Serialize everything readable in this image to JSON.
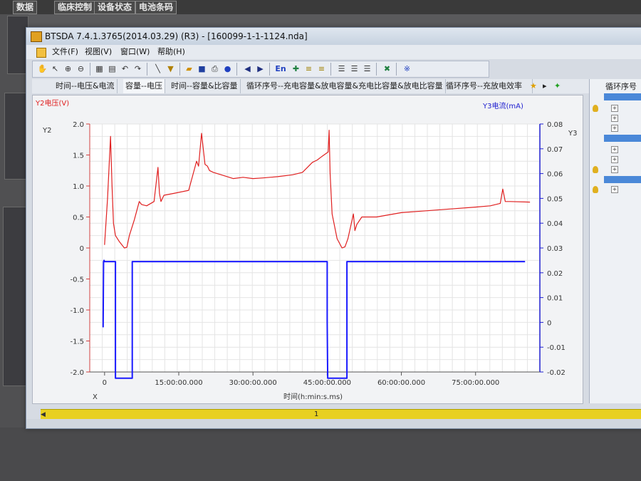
{
  "desktop_menu": [
    "数据",
    "临床控制",
    "设备状态",
    "电池条码"
  ],
  "window": {
    "title": "BTSDA 7.4.1.3765(2014.03.29) (R3) - [160099-1-1-1124.nda]"
  },
  "menubar": [
    "文件(F)",
    "视图(V)",
    "窗口(W)",
    "帮助(H)"
  ],
  "toolbar": {
    "icons": [
      "hand-icon",
      "pointer-icon",
      "zoom-in-icon",
      "zoom-out-icon",
      "table-icon",
      "grid-icon",
      "undo-icon",
      "redo-icon",
      "line-tool-icon",
      "filter-icon",
      "open-icon",
      "save-icon",
      "print-icon",
      "help-icon",
      "back-icon",
      "forward-icon",
      "lang-icon",
      "pin-icon",
      "axis-left-icon",
      "axis-right-icon",
      "layout-1-icon",
      "layout-2-icon",
      "layout-3-icon",
      "export-excel-icon",
      "settings-icon"
    ],
    "lang_label": "En"
  },
  "tabs": [
    "时间--电压&电流",
    "容量--电压",
    "时间--容量&比容量",
    "循环序号--充电容量&放电容量&充电比容量&放电比容量",
    "循环序号--充放电效率"
  ],
  "right_panel": {
    "header": "循环序号"
  },
  "scrollbar": {
    "position_label": "1"
  },
  "chart_data": {
    "type": "line",
    "xlabel": "时间(h:min:s.ms)",
    "x_axis_title": "X",
    "x_ticks": [
      "0",
      "15:00:00.000",
      "30:00:00.000",
      "45:00:00.000",
      "60:00:00.000",
      "75:00:00.000"
    ],
    "x_tick_values": [
      0,
      15,
      30,
      45,
      60,
      75
    ],
    "xlim": [
      -3,
      88
    ],
    "y2": {
      "label": "Y2电压(V)",
      "axis_title": "Y2",
      "ticks": [
        "2.0",
        "1.5",
        "1.0",
        "0.5",
        "0",
        "-0.5",
        "-1.0",
        "-1.5",
        "-2.0"
      ],
      "ylim": [
        -2.0,
        2.0
      ],
      "color": "#e02020"
    },
    "y3": {
      "label": "Y3电流(mA)",
      "axis_title": "Y3",
      "ticks": [
        "0.08",
        "0.07",
        "0.06",
        "0.05",
        "0.04",
        "0.03",
        "0.02",
        "0.01",
        "0",
        "-0.01",
        "-0.02"
      ],
      "ylim": [
        -0.02,
        0.08
      ],
      "color": "#1a1aff"
    },
    "series": [
      {
        "name": "Y2电压(V)",
        "axis": "y2",
        "color": "#e02020",
        "x": [
          0,
          0.6,
          1.2,
          1.5,
          1.8,
          2.2,
          3,
          4,
          4.5,
          5,
          6,
          7,
          7.5,
          8.5,
          10,
          10.8,
          11.1,
          11.4,
          12,
          14,
          17,
          18.2,
          18.6,
          19,
          19.6,
          20.3,
          20.8,
          21.2,
          22,
          24,
          26,
          28,
          30,
          32,
          35,
          38,
          40,
          41,
          42,
          43,
          44,
          45.2,
          45.4,
          45.6,
          46,
          47,
          48,
          48.6,
          49.2,
          50.3,
          50.6,
          51,
          52,
          55,
          60,
          65,
          70,
          75,
          78,
          80,
          80.5,
          81,
          82,
          86
        ],
        "y": [
          0.05,
          0.8,
          1.8,
          1.0,
          0.4,
          0.2,
          0.1,
          0.0,
          0.01,
          0.2,
          0.45,
          0.75,
          0.7,
          0.68,
          0.75,
          1.3,
          0.88,
          0.75,
          0.85,
          0.88,
          0.93,
          1.28,
          1.4,
          1.32,
          1.85,
          1.35,
          1.32,
          1.25,
          1.22,
          1.17,
          1.12,
          1.14,
          1.12,
          1.13,
          1.15,
          1.18,
          1.22,
          1.3,
          1.38,
          1.42,
          1.48,
          1.55,
          1.9,
          1.2,
          0.55,
          0.15,
          0.0,
          0.02,
          0.15,
          0.55,
          0.28,
          0.38,
          0.5,
          0.5,
          0.57,
          0.6,
          0.63,
          0.66,
          0.68,
          0.72,
          0.95,
          0.75,
          0.75,
          0.74
        ]
      },
      {
        "name": "Y3电流(mA)",
        "axis": "y3",
        "color": "#1a1aff",
        "x": [
          -0.3,
          -0.2,
          -0.1,
          0,
          2,
          2.2,
          2.2,
          5.6,
          5.6,
          45,
          45,
          45.1,
          45.1,
          49,
          49,
          85
        ],
        "y": [
          -0.002,
          0.0245,
          0.025,
          0.0245,
          0.0245,
          0.0245,
          -0.0225,
          -0.0225,
          0.0245,
          0.0245,
          0.0,
          -0.0225,
          -0.0225,
          -0.0225,
          0.0245,
          0.0245
        ]
      }
    ],
    "grid": true
  }
}
